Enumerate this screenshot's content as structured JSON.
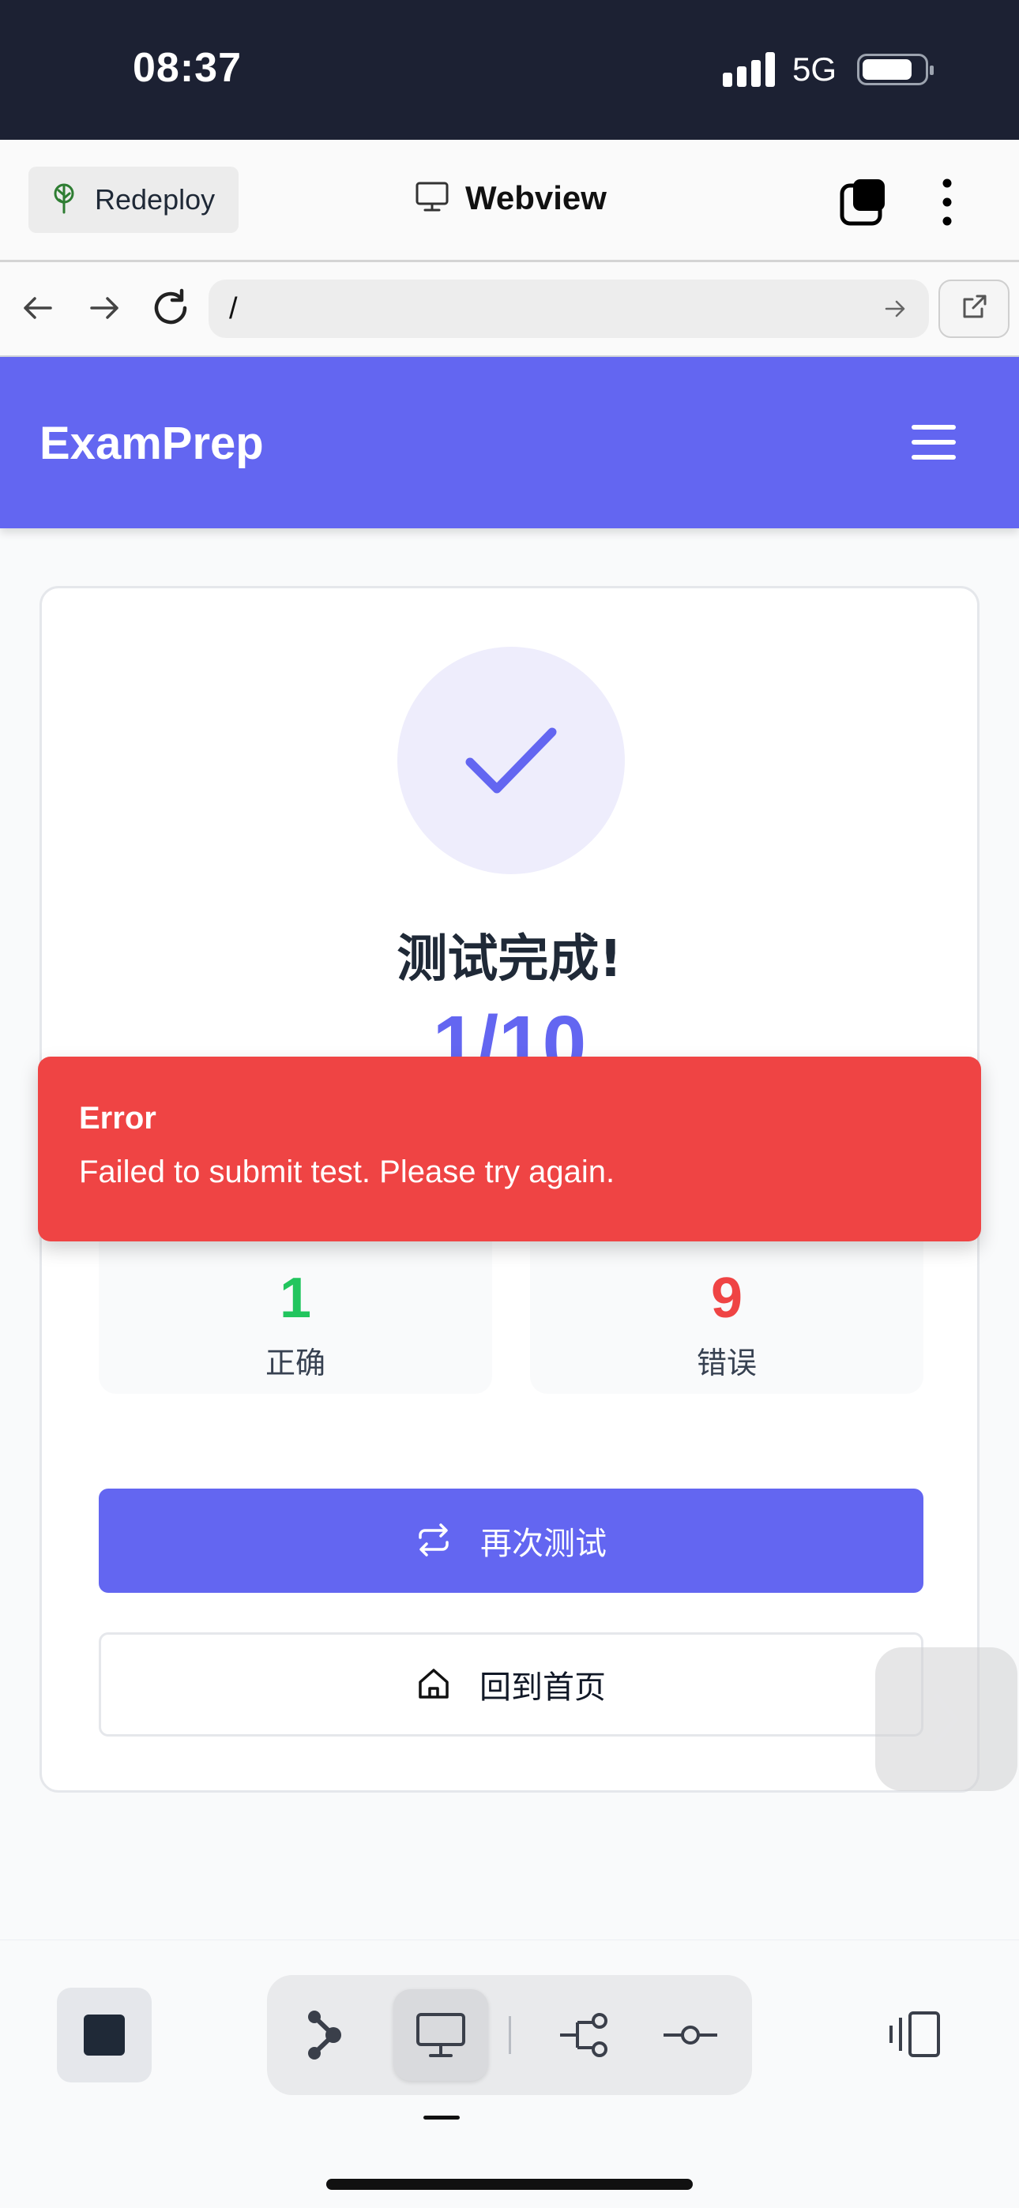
{
  "status_bar": {
    "time": "08:37",
    "network": "5G"
  },
  "webview_header": {
    "redeploy_label": "Redeploy",
    "title": "Webview"
  },
  "url_bar": {
    "value": "/"
  },
  "app": {
    "brand": "ExamPrep"
  },
  "result": {
    "title": "测试完成!",
    "score": "1/10",
    "correct": {
      "value": "1",
      "label": "正确",
      "color": "#22c55e"
    },
    "wrong": {
      "value": "9",
      "label": "错误",
      "color": "#ef4444"
    },
    "retry_label": "再次测试",
    "home_label": "回到首页"
  },
  "toast": {
    "title": "Error",
    "message": "Failed to submit test. Please try again."
  },
  "colors": {
    "accent": "#6366f1",
    "error": "#ef4444",
    "status_bar": "#1c2133"
  },
  "icons": {
    "redeploy": "tree-icon",
    "webview": "monitor-icon",
    "tabs": "tabs-icon",
    "more": "kebab-icon",
    "back": "arrow-left-icon",
    "forward": "arrow-right-icon",
    "reload": "reload-icon",
    "go": "arrow-right-icon",
    "external": "external-link-icon",
    "menu": "hamburger-icon",
    "check": "check-icon",
    "retry": "repeat-icon",
    "home": "home-icon",
    "toolbar": [
      "stop-icon",
      "graph-icon",
      "monitor-icon",
      "flow-icon",
      "commit-icon",
      "panel-icon"
    ]
  }
}
